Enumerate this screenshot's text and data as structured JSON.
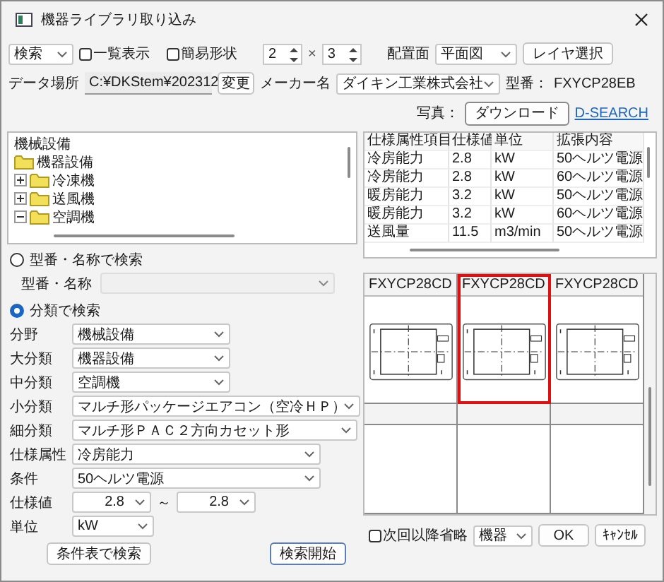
{
  "window": {
    "title": "機器ライブラリ取り込み"
  },
  "toolbar": {
    "mode": "検索",
    "list_view": {
      "label": "一覧表示",
      "checked": false
    },
    "simple_shape": {
      "label": "簡易形状",
      "checked": false
    },
    "rows": "2",
    "times": "×",
    "cols": "3",
    "placement_label": "配置面",
    "placement": "平面図",
    "layer_button": "レイヤ選択"
  },
  "data_location": {
    "label": "データ場所",
    "path": "C:¥DKStem¥202312",
    "change_button": "変更",
    "maker_label": "メーカー名",
    "maker": "ダイキン工業株式会社",
    "model_label": "型番：",
    "model": "FXYCP28EB"
  },
  "photo": {
    "label": "写真：",
    "download_button": "ダウンロード",
    "link": "D-SEARCH"
  },
  "tree": [
    {
      "label": "機械設備",
      "children": [
        {
          "label": "機器設備",
          "children": [
            {
              "label": "冷凍機",
              "expanded": false
            },
            {
              "label": "送風機",
              "expanded": false
            },
            {
              "label": "空調機",
              "expanded": true
            }
          ]
        }
      ]
    }
  ],
  "spec_table": {
    "columns": [
      "仕様属性項目",
      "仕様値",
      "単位",
      "拡張内容"
    ],
    "rows": [
      [
        "冷房能力",
        "2.8",
        "kW",
        "50ヘルツ電源"
      ],
      [
        "冷房能力",
        "2.8",
        "kW",
        "60ヘルツ電源"
      ],
      [
        "暖房能力",
        "3.2",
        "kW",
        "50ヘルツ電源"
      ],
      [
        "暖房能力",
        "3.2",
        "kW",
        "60ヘルツ電源"
      ],
      [
        "送風量",
        "11.5",
        "m3/min",
        "50ヘルツ電源"
      ]
    ]
  },
  "search_by_name": {
    "label": "型番・名称で検索",
    "selected": false,
    "field_label": "型番・名称"
  },
  "search_by_class": {
    "label": "分類で検索",
    "selected": true,
    "fields": [
      {
        "kind": "select",
        "label": "分野",
        "value": "機械設備"
      },
      {
        "kind": "select",
        "label": "大分類",
        "value": "機器設備"
      },
      {
        "kind": "select",
        "label": "中分類",
        "value": "空調機"
      },
      {
        "kind": "select",
        "label": "小分類",
        "value": "マルチ形パッケージエアコン（空冷ＨＰ）"
      },
      {
        "kind": "select",
        "label": "細分類",
        "value": "マルチ形ＰＡＣ２方向カセット形"
      },
      {
        "kind": "select",
        "label": "仕様属性",
        "value": "冷房能力"
      },
      {
        "kind": "select",
        "label": "条件",
        "value": "50ヘルツ電源"
      },
      {
        "kind": "range",
        "label": "仕様値",
        "from": "2.8",
        "separator": "～",
        "to": "2.8"
      },
      {
        "kind": "select",
        "label": "単位",
        "value": "kW"
      }
    ]
  },
  "condition_table_button": "条件表で検索",
  "start_button": "検索開始",
  "results": [
    {
      "kind": "unit",
      "title": "FXYCP28CD",
      "selected": false
    },
    {
      "kind": "unit",
      "title": "FXYCP28CD",
      "selected": true
    },
    {
      "kind": "unit",
      "title": "FXYCP28CD",
      "selected": false
    },
    {
      "kind": "empty",
      "selected": false
    },
    {
      "kind": "empty",
      "selected": false
    },
    {
      "kind": "empty",
      "selected": false
    }
  ],
  "footer": {
    "skip_next": {
      "label": "次回以降省略",
      "checked": false
    },
    "target": "機器",
    "ok_button": "OK",
    "cancel_button": "ｷｬﾝｾﾙ"
  }
}
